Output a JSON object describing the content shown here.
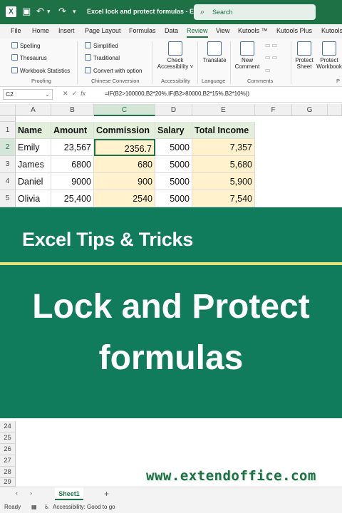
{
  "titlebar": {
    "app_icon": "X",
    "title": "Excel lock and protect formulas  -  E...",
    "search_placeholder": "Search"
  },
  "ribbon_tabs": [
    "File",
    "Home",
    "Insert",
    "Page Layout",
    "Formulas",
    "Data",
    "Review",
    "View",
    "Kutools ™",
    "Kutools Plus",
    "Kutools"
  ],
  "active_tab": "Review",
  "ribbon": {
    "proofing": {
      "items": [
        "Spelling",
        "Thesaurus",
        "Workbook Statistics"
      ],
      "label": "Proofing"
    },
    "chinese": {
      "items": [
        "Simplified",
        "Traditional",
        "Convert with option"
      ],
      "label": "Chinese Conversion"
    },
    "accessibility": {
      "button_line1": "Check",
      "button_line2": "Accessibility ˅",
      "label": "Accessibility"
    },
    "language": {
      "button": "Translate",
      "label": "Language"
    },
    "comments": {
      "button_line1": "New",
      "button_line2": "Comment",
      "label": "Comments"
    },
    "protect": {
      "sheet_line1": "Protect",
      "sheet_line2": "Sheet",
      "workbook_line1": "Protect",
      "workbook_line2": "Workbook",
      "label": "P"
    }
  },
  "formula_bar": {
    "name_box": "C2",
    "fx": "fx",
    "formula": "=IF(B2>100000,B2*20%,IF(B2>80000,B2*15%,B2*10%))"
  },
  "columns": [
    "A",
    "B",
    "C",
    "D",
    "E",
    "F",
    "G"
  ],
  "selected_column": "C",
  "rows": [
    "1",
    "2",
    "3",
    "4",
    "5"
  ],
  "table": {
    "headers": [
      "Name",
      "Amount",
      "Commission",
      "Salary",
      "Total Income"
    ],
    "data": [
      [
        "Emily",
        "23,567",
        "2356.7",
        "5000",
        "7,357"
      ],
      [
        "James",
        "6800",
        "680",
        "5000",
        "5,680"
      ],
      [
        "Daniel",
        "9000",
        "900",
        "5000",
        "5,900"
      ],
      [
        "Olivia",
        "25,400",
        "2540",
        "5000",
        "7,540"
      ]
    ]
  },
  "banner": {
    "tips": "Excel Tips & Tricks",
    "line1": "Lock and Protect",
    "line2": "formulas"
  },
  "lower_rows": [
    "24",
    "25",
    "26",
    "27",
    "28",
    "29"
  ],
  "watermark": "www.extendoffice.com",
  "sheet_tab": "Sheet1",
  "status": {
    "ready": "Ready",
    "accessibility": "Accessibility: Good to go"
  },
  "colors": {
    "excel_green": "#1e7145",
    "banner_green": "#107c5c",
    "header_fill": "#e2efda",
    "tint_fill": "#fff2cc",
    "rule_yellow": "#e9e27a"
  }
}
